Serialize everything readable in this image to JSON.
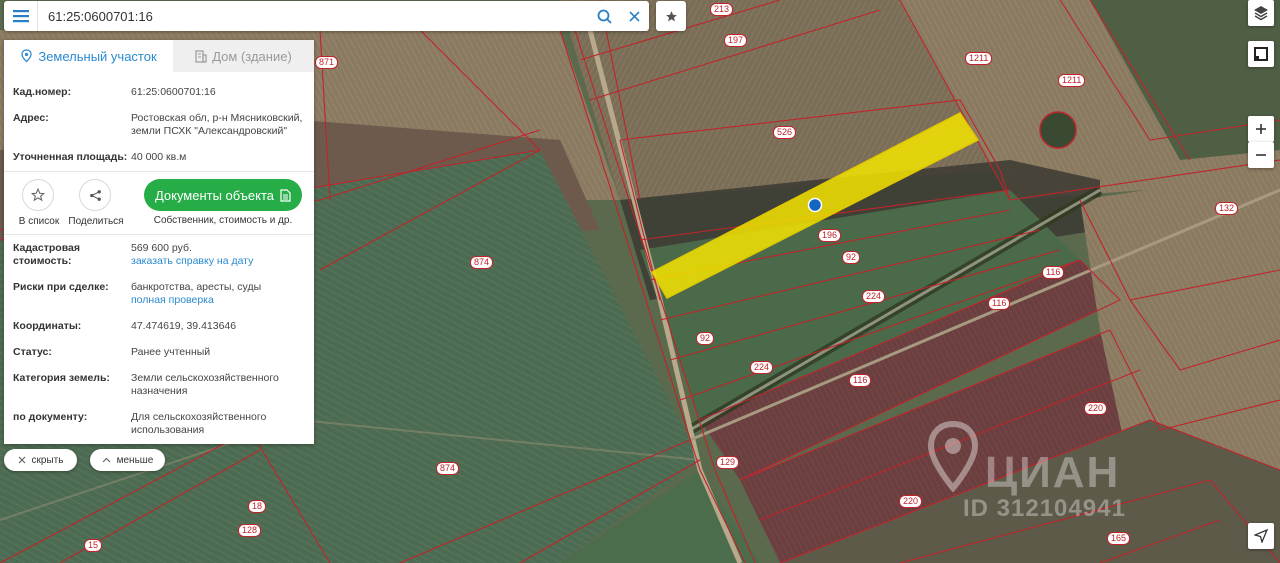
{
  "search": {
    "value": "61:25:0600701:16"
  },
  "tabs": [
    {
      "label": "Земельный участок",
      "active": true
    },
    {
      "label": "Дом (здание)",
      "active": false
    }
  ],
  "info": {
    "cad_label": "Кад.номер:",
    "cad_value": "61:25:0600701:16",
    "address_label": "Адрес:",
    "address_line1": "Ростовская обл, р-н Мясниковский,",
    "address_line2": "земли ПСХК \"Александровский\"",
    "area_label": "Уточненная площадь:",
    "area_value": "40 000 кв.м"
  },
  "actions": {
    "to_list": "В список",
    "share": "Поделиться",
    "docs_button": "Документы объекта",
    "docs_sub": "Собственник, стоимость и др."
  },
  "details": {
    "cad_cost_label1": "Кадастровая",
    "cad_cost_label2": "стоимость:",
    "cad_cost_value": "569 600 руб.",
    "cad_cost_link": "заказать справку на дату",
    "risks_label": "Риски при сделке:",
    "risks_value": "банкротства, аресты, суды",
    "risks_link": "полная проверка",
    "coords_label": "Координаты:",
    "coords_value": "47.474619, 39.413646",
    "status_label": "Статус:",
    "status_value": "Ранее учтенный",
    "category_label": "Категория земель:",
    "category_line1": "Земли сельскохозяйственного",
    "category_line2": "назначения",
    "bydoc_label": "по документу:",
    "bydoc_line1": "Для сельскохозяйственного",
    "bydoc_line2": "использования"
  },
  "bottom": {
    "hide": "скрыть",
    "less": "меньше"
  },
  "watermark": {
    "brand": "ЦИАН",
    "id": "ID 312104941"
  },
  "plot_labels": [
    "213",
    "197",
    "1211",
    "1211",
    "526",
    "871",
    "196",
    "92",
    "224",
    "92",
    "224",
    "116",
    "116",
    "116",
    "132",
    "874",
    "874",
    "220",
    "220",
    "129",
    "165",
    "18",
    "128",
    "15"
  ],
  "colors": {
    "accent": "#2a8ad0",
    "green_button": "#27ad48",
    "plot_border": "#c0242b",
    "selected_plot": "#f5e400"
  }
}
